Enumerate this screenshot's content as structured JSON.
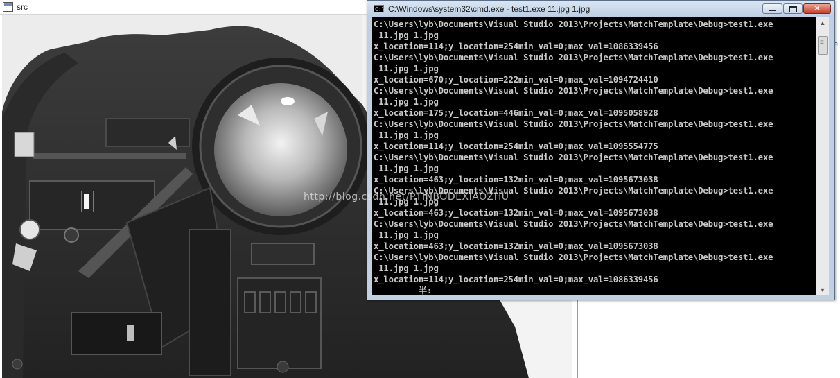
{
  "src_window": {
    "title": "src",
    "watermark": "http://blog.csdn.net/PTINBODEXIAOZHU"
  },
  "background_window": {
    "edge_text": "e"
  },
  "cmd_window": {
    "title": "C:\\Windows\\system32\\cmd.exe - test1.exe  11.jpg 1.jpg",
    "icon_text": "C:\\",
    "close_label": "✕",
    "lines": [
      "C:\\Users\\lyb\\Documents\\Visual Studio 2013\\Projects\\MatchTemplate\\Debug>test1.exe",
      " 11.jpg 1.jpg",
      "x_location=114;y_location=254min_val=0;max_val=1086339456",
      "C:\\Users\\lyb\\Documents\\Visual Studio 2013\\Projects\\MatchTemplate\\Debug>test1.exe",
      " 11.jpg 1.jpg",
      "x_location=670;y_location=222min_val=0;max_val=1094724410",
      "C:\\Users\\lyb\\Documents\\Visual Studio 2013\\Projects\\MatchTemplate\\Debug>test1.exe",
      " 11.jpg 1.jpg",
      "x_location=175;y_location=446min_val=0;max_val=1095058928",
      "C:\\Users\\lyb\\Documents\\Visual Studio 2013\\Projects\\MatchTemplate\\Debug>test1.exe",
      " 11.jpg 1.jpg",
      "x_location=114;y_location=254min_val=0;max_val=1095554775",
      "C:\\Users\\lyb\\Documents\\Visual Studio 2013\\Projects\\MatchTemplate\\Debug>test1.exe",
      " 11.jpg 1.jpg",
      "x_location=463;y_location=132min_val=0;max_val=1095673038",
      "C:\\Users\\lyb\\Documents\\Visual Studio 2013\\Projects\\MatchTemplate\\Debug>test1.exe",
      " 11.jpg 1.jpg",
      "x_location=463;y_location=132min_val=0;max_val=1095673038",
      "C:\\Users\\lyb\\Documents\\Visual Studio 2013\\Projects\\MatchTemplate\\Debug>test1.exe",
      " 11.jpg 1.jpg",
      "x_location=463;y_location=132min_val=0;max_val=1095673038",
      "C:\\Users\\lyb\\Documents\\Visual Studio 2013\\Projects\\MatchTemplate\\Debug>test1.exe",
      " 11.jpg 1.jpg",
      "x_location=114;y_location=254min_val=0;max_val=1086339456",
      "         半:"
    ]
  },
  "colors": {
    "match_box": "#15c415",
    "console_bg": "#000000",
    "console_text": "#c8c8c8"
  }
}
